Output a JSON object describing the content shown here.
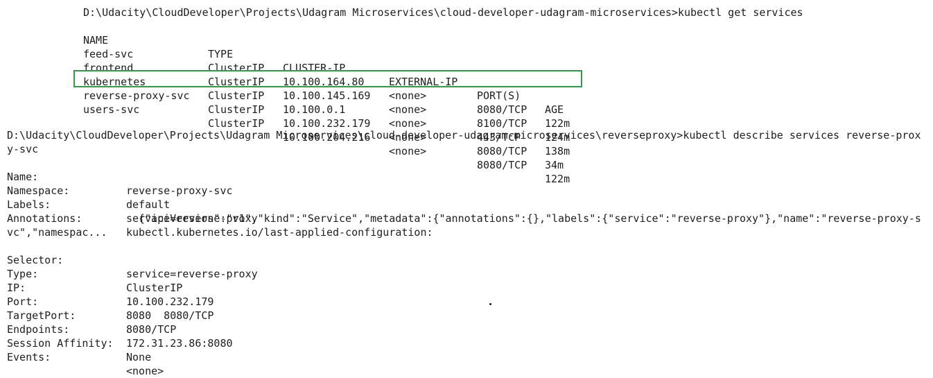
{
  "first_command": "D:\\Udacity\\CloudDeveloper\\Projects\\Udagram Microservices\\cloud-developer-udagram-microservices>kubectl get services",
  "services_table": {
    "headers": [
      "NAME",
      "TYPE",
      "CLUSTER-IP",
      "EXTERNAL-IP",
      "PORT(S)",
      "AGE"
    ],
    "rows": [
      [
        "feed-svc",
        "ClusterIP",
        "10.100.164.80",
        "<none>",
        "8080/TCP",
        "122m"
      ],
      [
        "frontend",
        "ClusterIP",
        "10.100.145.169",
        "<none>",
        "8100/TCP",
        "124m"
      ],
      [
        "kubernetes",
        "ClusterIP",
        "10.100.0.1",
        "<none>",
        "443/TCP",
        "138m"
      ],
      [
        "reverse-proxy-svc",
        "ClusterIP",
        "10.100.232.179",
        "<none>",
        "8080/TCP",
        "34m"
      ],
      [
        "users-svc",
        "ClusterIP",
        "10.100.204.216",
        "<none>",
        "8080/TCP",
        "122m"
      ]
    ]
  },
  "second_command_line1": "D:\\Udacity\\CloudDeveloper\\Projects\\Udagram Microservices\\cloud-developer-udagram-microservices\\reverseproxy>kubectl describe services reverse-prox",
  "second_command_line2": "y-svc",
  "describe": {
    "name_key": "Name:",
    "name_val": "reverse-proxy-svc",
    "namespace_key": "Namespace:",
    "namespace_val": "default",
    "labels_key": "Labels:",
    "labels_val": "service=reverse-proxy",
    "annotations_key": "Annotations:",
    "annotations_val": "kubectl.kubernetes.io/last-applied-configuration:",
    "annotations_json_line1": "{\"apiVersion\":\"v1\",\"kind\":\"Service\",\"metadata\":{\"annotations\":{},\"labels\":{\"service\":\"reverse-proxy\"},\"name\":\"reverse-proxy-s",
    "annotations_json_line2": "vc\",\"namespac...",
    "selector_key": "Selector:",
    "selector_val": "service=reverse-proxy",
    "type_key": "Type:",
    "type_val": "ClusterIP",
    "ip_key": "IP:",
    "ip_val": "10.100.232.179",
    "port_key": "Port:",
    "port_val": "8080  8080/TCP",
    "targetport_key": "TargetPort:",
    "targetport_val": "8080/TCP",
    "endpoints_key": "Endpoints:",
    "endpoints_val": "172.31.23.86:8080",
    "affinity_key": "Session Affinity:",
    "affinity_val": "None",
    "events_key": "Events:",
    "events_val": "<none>"
  },
  "colors": {
    "text": "#1e1e1e",
    "highlight_border": "#2ea043",
    "background": "#ffffff"
  }
}
